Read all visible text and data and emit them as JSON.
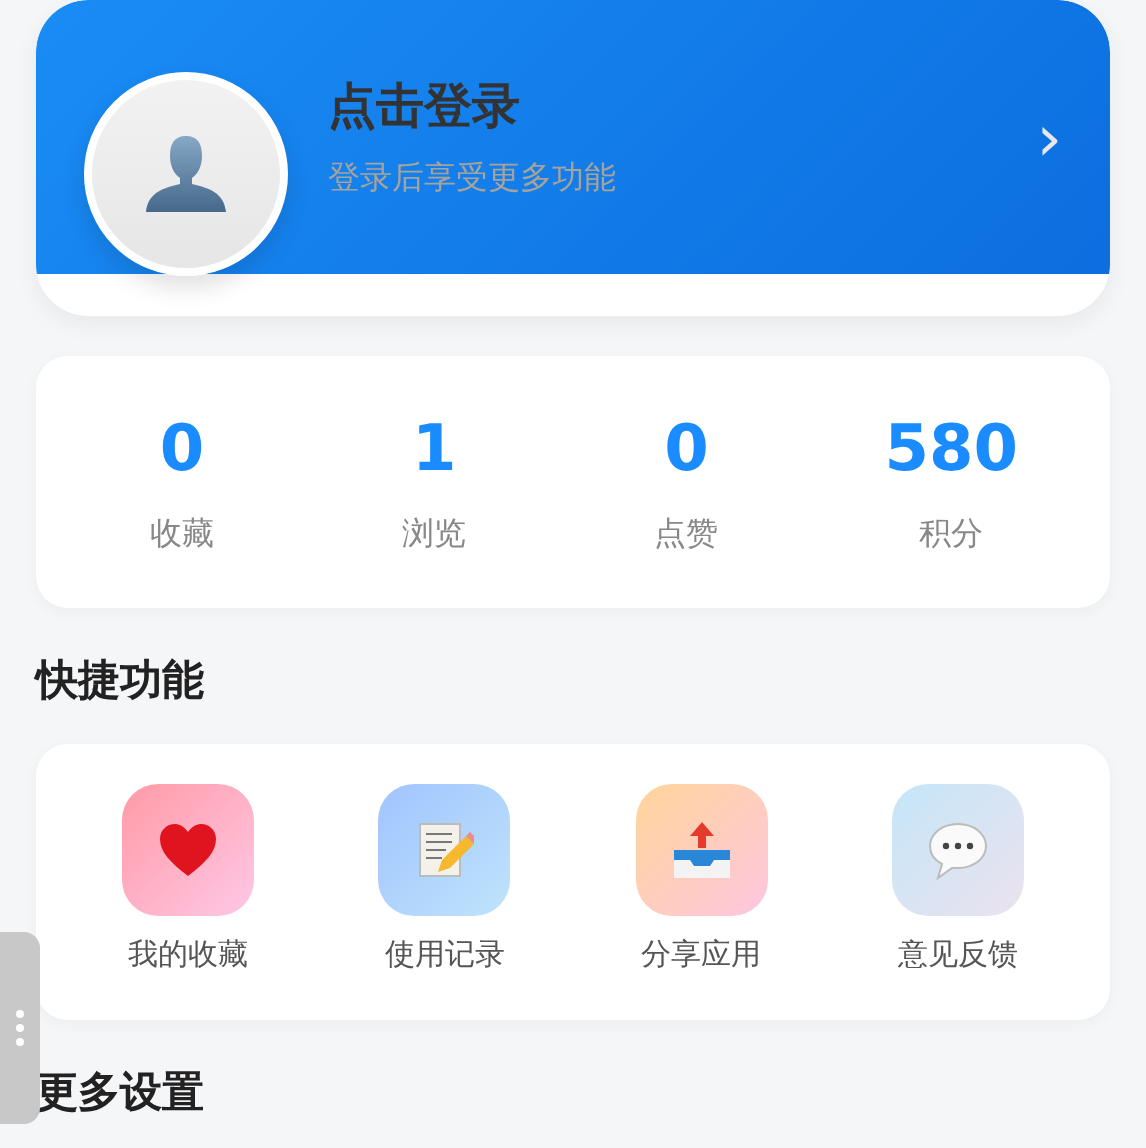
{
  "profile": {
    "title": "点击登录",
    "subtitle": "登录后享受更多功能",
    "chevron": "›"
  },
  "stats": [
    {
      "value": "0",
      "label": "收藏"
    },
    {
      "value": "1",
      "label": "浏览"
    },
    {
      "value": "0",
      "label": "点赞"
    },
    {
      "value": "580",
      "label": "积分"
    }
  ],
  "quick_section": {
    "title": "快捷功能",
    "items": [
      {
        "label": "我的收藏",
        "kind": "heart"
      },
      {
        "label": "使用记录",
        "kind": "notes"
      },
      {
        "label": "分享应用",
        "kind": "share"
      },
      {
        "label": "意见反馈",
        "kind": "chat"
      }
    ]
  },
  "more_section": {
    "title": "更多设置"
  }
}
